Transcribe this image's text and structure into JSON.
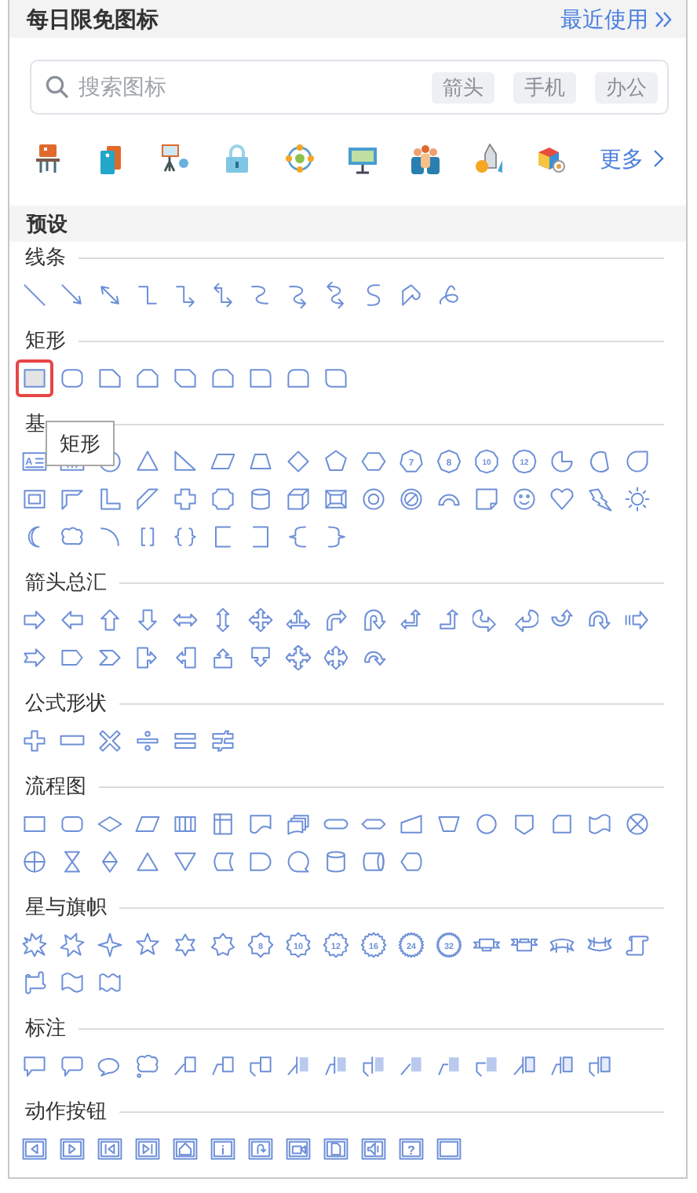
{
  "header": {
    "title": "每日限免图标",
    "link": "最近使用"
  },
  "search": {
    "placeholder": "搜索图标",
    "chips": [
      "箭头",
      "手机",
      "办公"
    ]
  },
  "more_link": "更多",
  "preset_title": "预设",
  "sections": [
    {
      "title": "线条",
      "shapes": [
        {
          "kind": "line",
          "selected": false
        },
        {
          "kind": "arrow-line",
          "selected": false
        },
        {
          "kind": "double-arrow-line",
          "selected": false
        },
        {
          "kind": "elbow-connector",
          "selected": false
        },
        {
          "kind": "elbow-arrow",
          "selected": false
        },
        {
          "kind": "elbow-double-arrow",
          "selected": false
        },
        {
          "kind": "curved-connector",
          "selected": false
        },
        {
          "kind": "curved-arrow",
          "selected": false
        },
        {
          "kind": "curved-double-arrow",
          "selected": false
        },
        {
          "kind": "curve",
          "selected": false
        },
        {
          "kind": "freeform",
          "selected": false
        },
        {
          "kind": "scribble",
          "selected": false
        }
      ]
    },
    {
      "title": "矩形",
      "shapes": [
        {
          "kind": "rectangle",
          "selected": true
        },
        {
          "kind": "rounded-rectangle",
          "selected": false
        },
        {
          "kind": "snip-single",
          "selected": false
        },
        {
          "kind": "snip-same",
          "selected": false
        },
        {
          "kind": "snip-diagonal",
          "selected": false
        },
        {
          "kind": "snip-round",
          "selected": false
        },
        {
          "kind": "round-single",
          "selected": false
        },
        {
          "kind": "round-same",
          "selected": false
        },
        {
          "kind": "round-diagonal",
          "selected": false
        }
      ]
    },
    {
      "title": "基",
      "shapes": [
        {
          "kind": "text-box",
          "label": "A",
          "selected": false
        },
        {
          "kind": "vertical-text-box",
          "selected": false
        },
        {
          "kind": "oval",
          "selected": false
        },
        {
          "kind": "triangle",
          "selected": false
        },
        {
          "kind": "right-triangle",
          "selected": false
        },
        {
          "kind": "parallelogram",
          "selected": false
        },
        {
          "kind": "trapezoid",
          "selected": false
        },
        {
          "kind": "diamond",
          "selected": false
        },
        {
          "kind": "pentagon",
          "selected": false
        },
        {
          "kind": "hexagon",
          "selected": false
        },
        {
          "kind": "heptagon",
          "label": "7",
          "selected": false
        },
        {
          "kind": "octagon",
          "label": "8",
          "selected": false
        },
        {
          "kind": "decagon",
          "label": "10",
          "selected": false
        },
        {
          "kind": "dodecagon",
          "label": "12",
          "selected": false
        },
        {
          "kind": "pie",
          "selected": false
        },
        {
          "kind": "chord",
          "selected": false
        },
        {
          "kind": "teardrop",
          "selected": false
        },
        {
          "kind": "frame",
          "selected": false
        },
        {
          "kind": "half-frame",
          "selected": false
        },
        {
          "kind": "l-shape",
          "selected": false
        },
        {
          "kind": "diagonal-stripe",
          "selected": false
        },
        {
          "kind": "cross",
          "selected": false
        },
        {
          "kind": "plaque",
          "selected": false
        },
        {
          "kind": "can",
          "selected": false
        },
        {
          "kind": "cube",
          "selected": false
        },
        {
          "kind": "bevel",
          "selected": false
        },
        {
          "kind": "donut",
          "selected": false
        },
        {
          "kind": "no-symbol",
          "selected": false
        },
        {
          "kind": "block-arc",
          "selected": false
        },
        {
          "kind": "folded-corner",
          "selected": false
        },
        {
          "kind": "smiley",
          "selected": false
        },
        {
          "kind": "heart",
          "selected": false
        },
        {
          "kind": "lightning",
          "selected": false
        },
        {
          "kind": "sun",
          "selected": false
        },
        {
          "kind": "moon",
          "selected": false
        },
        {
          "kind": "cloud",
          "selected": false
        },
        {
          "kind": "arc",
          "selected": false
        },
        {
          "kind": "double-bracket",
          "selected": false
        },
        {
          "kind": "double-brace",
          "selected": false
        },
        {
          "kind": "left-bracket",
          "selected": false
        },
        {
          "kind": "right-bracket",
          "selected": false
        },
        {
          "kind": "left-brace",
          "selected": false
        },
        {
          "kind": "right-brace",
          "selected": false
        }
      ]
    },
    {
      "title": "箭头总汇",
      "shapes": [
        {
          "kind": "right-arrow",
          "selected": false
        },
        {
          "kind": "left-arrow",
          "selected": false
        },
        {
          "kind": "up-arrow",
          "selected": false
        },
        {
          "kind": "down-arrow",
          "selected": false
        },
        {
          "kind": "left-right-arrow",
          "selected": false
        },
        {
          "kind": "up-down-arrow",
          "selected": false
        },
        {
          "kind": "quad-arrow",
          "selected": false
        },
        {
          "kind": "left-right-up-arrow",
          "selected": false
        },
        {
          "kind": "bent-arrow",
          "selected": false
        },
        {
          "kind": "u-turn-arrow",
          "selected": false
        },
        {
          "kind": "left-up-arrow",
          "selected": false
        },
        {
          "kind": "bent-up-arrow",
          "selected": false
        },
        {
          "kind": "curved-right-arrow",
          "selected": false
        },
        {
          "kind": "curved-left-arrow",
          "selected": false
        },
        {
          "kind": "curved-up-arrow",
          "selected": false
        },
        {
          "kind": "curved-down-arrow",
          "selected": false
        },
        {
          "kind": "striped-right-arrow",
          "selected": false
        },
        {
          "kind": "notched-right-arrow",
          "selected": false
        },
        {
          "kind": "pentagon-arrow",
          "selected": false
        },
        {
          "kind": "chevron",
          "selected": false
        },
        {
          "kind": "right-arrow-callout",
          "selected": false
        },
        {
          "kind": "left-arrow-callout",
          "selected": false
        },
        {
          "kind": "up-arrow-callout",
          "selected": false
        },
        {
          "kind": "down-arrow-callout",
          "selected": false
        },
        {
          "kind": "cross-arrow-callout",
          "selected": false
        },
        {
          "kind": "quad-arrow-callout",
          "selected": false
        },
        {
          "kind": "circular-arrow",
          "selected": false
        }
      ]
    },
    {
      "title": "公式形状",
      "shapes": [
        {
          "kind": "math-plus",
          "selected": false
        },
        {
          "kind": "math-minus",
          "selected": false
        },
        {
          "kind": "math-multiply",
          "selected": false
        },
        {
          "kind": "math-divide",
          "selected": false
        },
        {
          "kind": "math-equal",
          "selected": false
        },
        {
          "kind": "math-not-equal",
          "selected": false
        }
      ]
    },
    {
      "title": "流程图",
      "shapes": [
        {
          "kind": "fc-process",
          "selected": false
        },
        {
          "kind": "fc-alternate",
          "selected": false
        },
        {
          "kind": "fc-decision",
          "selected": false
        },
        {
          "kind": "fc-data",
          "selected": false
        },
        {
          "kind": "fc-predefined",
          "selected": false
        },
        {
          "kind": "fc-internal",
          "selected": false
        },
        {
          "kind": "fc-document",
          "selected": false
        },
        {
          "kind": "fc-multidocument",
          "selected": false
        },
        {
          "kind": "fc-terminator",
          "selected": false
        },
        {
          "kind": "fc-preparation",
          "selected": false
        },
        {
          "kind": "fc-manual-input",
          "selected": false
        },
        {
          "kind": "fc-manual-operation",
          "selected": false
        },
        {
          "kind": "fc-connector",
          "selected": false
        },
        {
          "kind": "fc-offpage",
          "selected": false
        },
        {
          "kind": "fc-card",
          "selected": false
        },
        {
          "kind": "fc-punched-tape",
          "selected": false
        },
        {
          "kind": "fc-summing",
          "selected": false
        },
        {
          "kind": "fc-or",
          "selected": false
        },
        {
          "kind": "fc-collate",
          "selected": false
        },
        {
          "kind": "fc-sort",
          "selected": false
        },
        {
          "kind": "fc-extract",
          "selected": false
        },
        {
          "kind": "fc-merge",
          "selected": false
        },
        {
          "kind": "fc-stored-data",
          "selected": false
        },
        {
          "kind": "fc-delay",
          "selected": false
        },
        {
          "kind": "fc-sequential",
          "selected": false
        },
        {
          "kind": "fc-disk",
          "selected": false
        },
        {
          "kind": "fc-direct-access",
          "selected": false
        },
        {
          "kind": "fc-display",
          "selected": false
        }
      ]
    },
    {
      "title": "星与旗帜",
      "shapes": [
        {
          "kind": "explosion",
          "selected": false
        },
        {
          "kind": "explosion-2",
          "selected": false
        },
        {
          "kind": "star-4",
          "selected": false
        },
        {
          "kind": "star-5",
          "selected": false
        },
        {
          "kind": "star-6",
          "selected": false
        },
        {
          "kind": "star-7",
          "selected": false
        },
        {
          "kind": "star-8",
          "label": "8",
          "selected": false
        },
        {
          "kind": "star-10",
          "label": "10",
          "selected": false
        },
        {
          "kind": "star-12",
          "label": "12",
          "selected": false
        },
        {
          "kind": "star-16",
          "label": "16",
          "selected": false
        },
        {
          "kind": "star-24",
          "label": "24",
          "selected": false
        },
        {
          "kind": "star-32",
          "label": "32",
          "selected": false
        },
        {
          "kind": "ribbon-down",
          "selected": false
        },
        {
          "kind": "ribbon-up",
          "selected": false
        },
        {
          "kind": "curved-ribbon-down",
          "selected": false
        },
        {
          "kind": "curved-ribbon-up",
          "selected": false
        },
        {
          "kind": "vertical-scroll",
          "selected": false
        },
        {
          "kind": "horizontal-scroll",
          "selected": false
        },
        {
          "kind": "wave",
          "selected": false
        },
        {
          "kind": "double-wave",
          "selected": false
        }
      ]
    },
    {
      "title": "标注",
      "shapes": [
        {
          "kind": "rect-callout",
          "selected": false
        },
        {
          "kind": "rounded-callout",
          "selected": false
        },
        {
          "kind": "oval-callout",
          "selected": false
        },
        {
          "kind": "cloud-callout",
          "selected": false
        },
        {
          "kind": "line-callout-1",
          "selected": false
        },
        {
          "kind": "line-callout-2",
          "selected": false
        },
        {
          "kind": "line-callout-3",
          "selected": false
        },
        {
          "kind": "accent-callout-1",
          "selected": false
        },
        {
          "kind": "accent-callout-2",
          "selected": false
        },
        {
          "kind": "accent-callout-3",
          "selected": false
        },
        {
          "kind": "border-callout-1",
          "selected": false
        },
        {
          "kind": "border-callout-2",
          "selected": false
        },
        {
          "kind": "border-callout-3",
          "selected": false
        },
        {
          "kind": "accent-border-callout-1",
          "selected": false
        },
        {
          "kind": "accent-border-callout-2",
          "selected": false
        },
        {
          "kind": "accent-border-callout-3",
          "selected": false
        }
      ]
    },
    {
      "title": "动作按钮",
      "shapes": [
        {
          "kind": "action-back",
          "selected": false
        },
        {
          "kind": "action-forward",
          "selected": false
        },
        {
          "kind": "action-beginning",
          "selected": false
        },
        {
          "kind": "action-end",
          "selected": false
        },
        {
          "kind": "action-home",
          "selected": false
        },
        {
          "kind": "action-info",
          "label": "i",
          "selected": false
        },
        {
          "kind": "action-return",
          "selected": false
        },
        {
          "kind": "action-movie",
          "selected": false
        },
        {
          "kind": "action-document",
          "selected": false
        },
        {
          "kind": "action-sound",
          "selected": false
        },
        {
          "kind": "action-help",
          "label": "?",
          "selected": false
        },
        {
          "kind": "action-custom",
          "selected": false
        }
      ]
    }
  ],
  "tooltip": "矩形"
}
